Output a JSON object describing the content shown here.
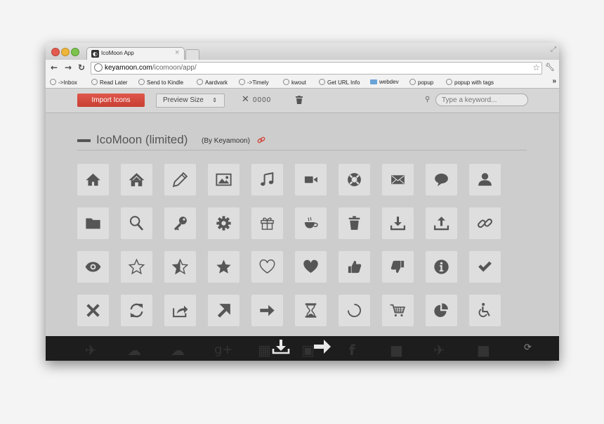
{
  "browser": {
    "tab_title": "IcoMoon App",
    "tab_close": "×",
    "url_host": "keyamoon.com",
    "url_path": "/icomoon/app/",
    "bookmarks": [
      "->Inbox",
      "Read Later",
      "Send to Kindle",
      "Aardvark",
      "->Timely",
      "kwout",
      "Get URL Info",
      "webdev",
      "popup",
      "popup with tags"
    ],
    "bookmarks_more": "»"
  },
  "appbar": {
    "import_label": "Import Icons",
    "preview_label": "Preview Size",
    "preview_arrows": "⇕",
    "selection_count": "0000",
    "search_placeholder": "Type a keyword..."
  },
  "iconset": {
    "title": "IcoMoon (limited)",
    "author": "(By Keyamoon)"
  },
  "icons": [
    [
      "home",
      "home-alt",
      "pencil",
      "image",
      "music",
      "video",
      "lifebuoy",
      "mail",
      "bubble",
      "user"
    ],
    [
      "folder",
      "search",
      "key",
      "cog",
      "gift",
      "cup",
      "trash",
      "download",
      "upload",
      "link"
    ],
    [
      "eye",
      "star-empty",
      "star-half",
      "star-full",
      "heart-empty",
      "heart-full",
      "thumbs-up",
      "thumbs-down",
      "info",
      "checkmark"
    ],
    [
      "close",
      "refresh",
      "share",
      "arrow-up-right",
      "arrow-right",
      "hourglass",
      "spinner",
      "cart",
      "pie-chart",
      "accessibility"
    ]
  ],
  "footer_icons": [
    "rocket",
    "cloud-download",
    "cloud-upload",
    "google-plus",
    "calendar",
    "download",
    "feed",
    "arrow-right",
    "facebook",
    "facebook-square",
    "twitter",
    "twitter-square"
  ],
  "colors": {
    "accent": "#d04b40",
    "icon": "#565656",
    "tile": "#dedede",
    "footer": "#1d1d1d"
  }
}
